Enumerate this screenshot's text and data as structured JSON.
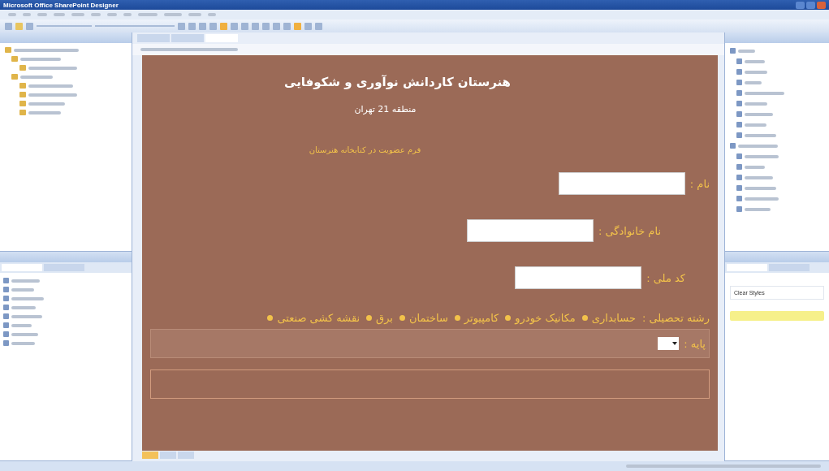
{
  "window": {
    "title": "Microsoft Office SharePoint Designer"
  },
  "left_panel": {
    "tabs": [
      {
        "selected": true
      },
      {
        "selected": false
      }
    ]
  },
  "doc_tabs": [
    {
      "selected": false
    },
    {
      "selected": false
    },
    {
      "selected": true
    }
  ],
  "page": {
    "title": "هنرستان کاردانش نوآوری و شکوفایی",
    "subtitle": "منطقه 21 تهران",
    "form_heading": "فرم عضویت در کتابخانه هنرستان",
    "fields": [
      {
        "label": "نام :"
      },
      {
        "label": "نام خانوادگی :"
      },
      {
        "label": "کد ملی :"
      }
    ],
    "major_label": "رشته تحصیلی :",
    "majors": [
      {
        "label": "حسابداری",
        "selected": false
      },
      {
        "label": "مکانیک خودرو",
        "selected": false
      },
      {
        "label": "کامپیوتر",
        "selected": false
      },
      {
        "label": "ساختمان",
        "selected": false
      },
      {
        "label": "برق",
        "selected": false
      },
      {
        "label": "نقشه کشی صنعتی",
        "selected": false
      }
    ],
    "grade_label": "پایه :"
  },
  "view_tabs": [
    {
      "selected": true
    },
    {
      "selected": false
    },
    {
      "selected": false
    }
  ],
  "right_panel": {
    "tabs": [
      {
        "selected": true
      },
      {
        "selected": false
      }
    ],
    "clear_styles": "Clear Styles"
  }
}
